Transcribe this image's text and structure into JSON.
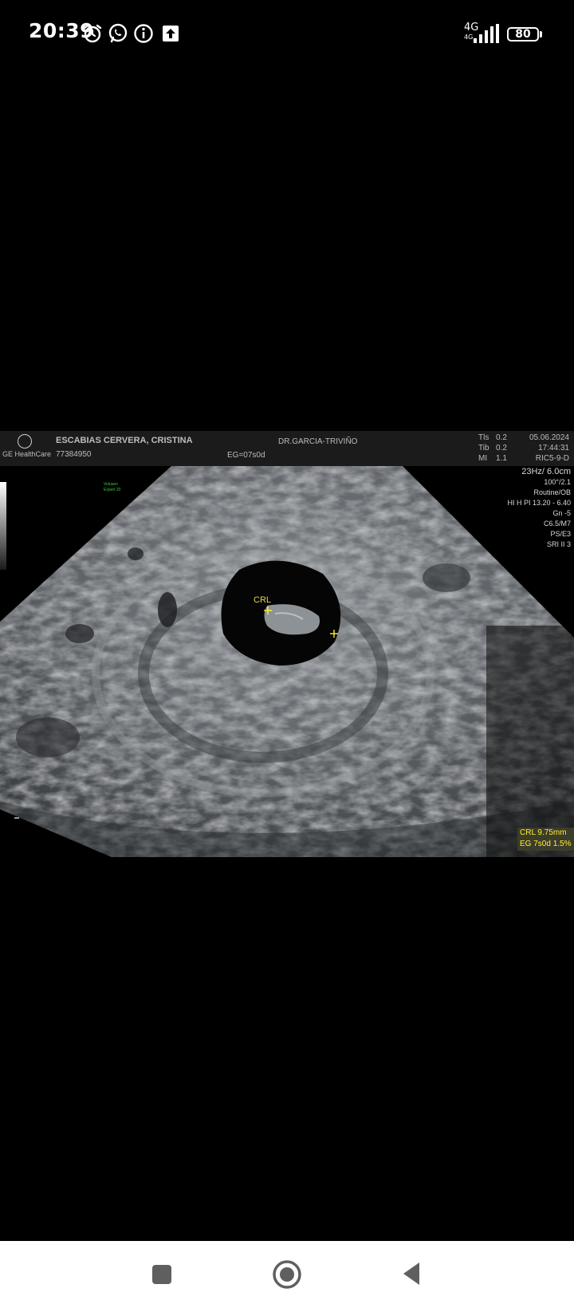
{
  "status_bar": {
    "time": "20:39",
    "icons": [
      "alarm-icon",
      "whatsapp-icon",
      "info-icon",
      "upload-icon"
    ],
    "network": "4G",
    "network_sub": "4G",
    "battery": "80"
  },
  "ultrasound": {
    "brand": "GE HealthCare",
    "patient_name": "ESCABIAS CERVERA, CRISTINA",
    "patient_id": "77384950",
    "doctor": "DR.GARCIA-TRIVIÑO",
    "gestational_age": "EG=07s0d",
    "indices": [
      {
        "label": "Tls",
        "value": "0.2"
      },
      {
        "label": "Tib",
        "value": "0.2"
      },
      {
        "label": "MI",
        "value": "1.1"
      }
    ],
    "date": "05.06.2024",
    "time": "17:44:31",
    "probe": "RIC5-9-D",
    "params": [
      "23Hz/ 6.0cm",
      "100°/2.1",
      "Routine/OB",
      "HI H PI 13.20 - 6.40",
      "Gn -5",
      "C6.5/M7",
      "PS/E3",
      "SRI II 3"
    ],
    "volume_label": [
      "Volusen",
      "Expert 20"
    ],
    "crl_marker": "CRL",
    "measurement": {
      "line1": "CRL   9.75mm",
      "line2": "EG 7s0d 1.5%"
    }
  },
  "nav_bar": {
    "buttons": [
      "recents-button",
      "home-button",
      "back-button"
    ]
  }
}
